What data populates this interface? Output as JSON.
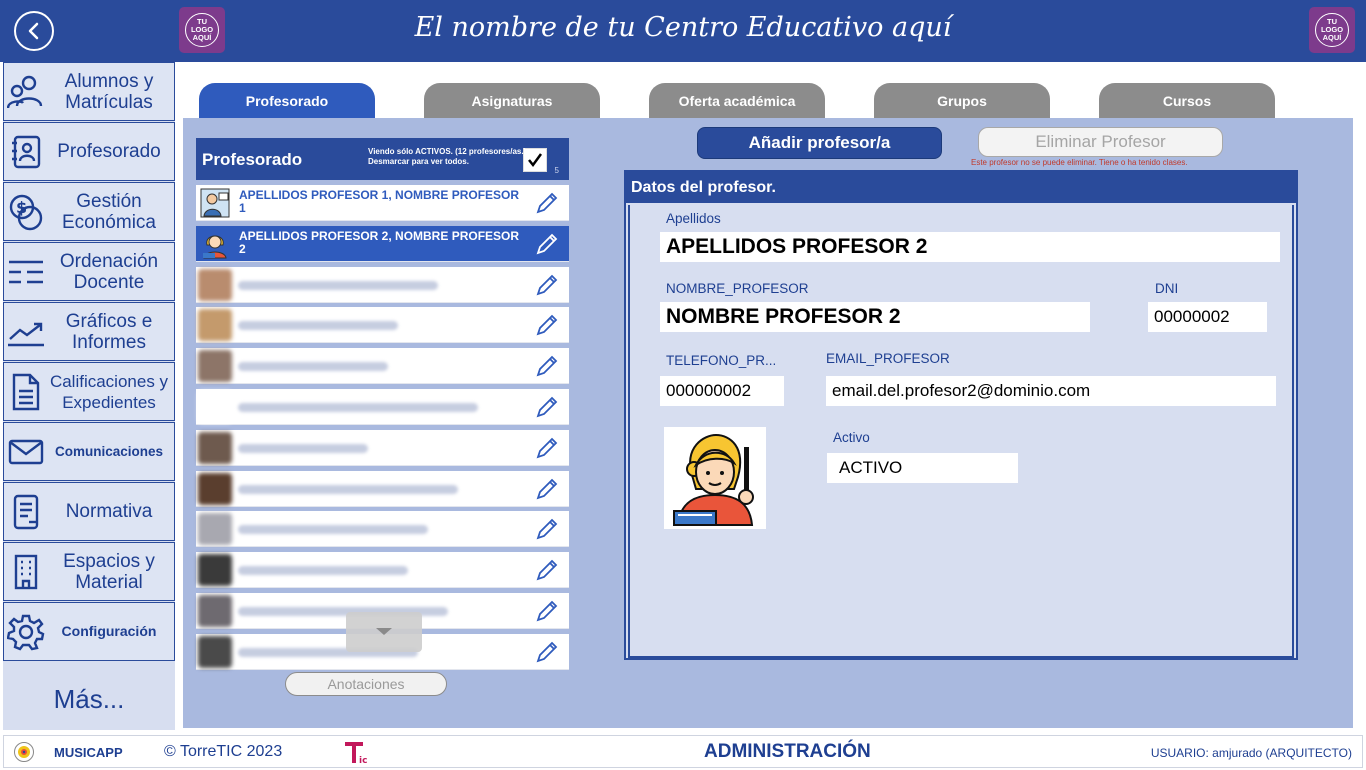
{
  "header": {
    "center_name": "El nombre de tu Centro Educativo aquí",
    "logo_text": [
      "TU",
      "LOGO",
      "AQUÍ"
    ]
  },
  "sidebar": {
    "items": [
      {
        "label": "Alumnos y Matrículas",
        "icon": "users-icon"
      },
      {
        "label": "Profesorado",
        "icon": "teacher-card-icon"
      },
      {
        "label": "Gestión Económica",
        "icon": "money-icon"
      },
      {
        "label": "Ordenación Docente",
        "icon": "list-icon"
      },
      {
        "label": "Gráficos e Informes",
        "icon": "chart-icon"
      },
      {
        "label": "Calificaciones y Expedientes",
        "icon": "document-icon"
      },
      {
        "label": "Comunicaciones",
        "icon": "envelope-icon"
      },
      {
        "label": "Normativa",
        "icon": "regulation-icon"
      },
      {
        "label": "Espacios y Material",
        "icon": "building-icon"
      },
      {
        "label": "Configuración",
        "icon": "gear-icon"
      }
    ],
    "more": "Más..."
  },
  "tabs": [
    {
      "label": "Profesorado",
      "active": true
    },
    {
      "label": "Asignaturas",
      "active": false
    },
    {
      "label": "Oferta académica",
      "active": false
    },
    {
      "label": "Grupos",
      "active": false
    },
    {
      "label": "Cursos",
      "active": false
    }
  ],
  "list": {
    "title": "Profesorado",
    "checked": true,
    "note_line1": "Viendo sólo ACTIVOS. (12 profesores/as.)",
    "note_line2": "Desmarcar para ver todos.",
    "count": "5",
    "rows": [
      {
        "name": "APELLIDOS PROFESOR 1, NOMBRE PROFESOR 1",
        "selected": false,
        "blurred": false
      },
      {
        "name": "APELLIDOS PROFESOR 2, NOMBRE PROFESOR 2",
        "selected": true,
        "blurred": false
      },
      {
        "name": "",
        "selected": false,
        "blurred": true
      },
      {
        "name": "",
        "selected": false,
        "blurred": true
      },
      {
        "name": "",
        "selected": false,
        "blurred": true
      },
      {
        "name": "",
        "selected": false,
        "blurred": true
      },
      {
        "name": "",
        "selected": false,
        "blurred": true
      },
      {
        "name": "",
        "selected": false,
        "blurred": true
      },
      {
        "name": "",
        "selected": false,
        "blurred": true
      },
      {
        "name": "",
        "selected": false,
        "blurred": true
      },
      {
        "name": "",
        "selected": false,
        "blurred": true
      },
      {
        "name": "",
        "selected": false,
        "blurred": true
      }
    ],
    "annotations_button": "Anotaciones"
  },
  "actions": {
    "add_label": "Añadir profesor/a",
    "delete_label": "Eliminar Profesor",
    "delete_warning": "Este profesor no se puede eliminar. Tiene o ha tenido clases."
  },
  "detail": {
    "title": "Datos del profesor.",
    "apellidos_label": "Apellidos",
    "apellidos_value": "APELLIDOS PROFESOR 2",
    "nombre_label": "NOMBRE_PROFESOR",
    "nombre_value": "NOMBRE PROFESOR 2",
    "dni_label": "DNI",
    "dni_value": "00000002",
    "telefono_label": "TELEFONO_PR...",
    "telefono_value": "000000002",
    "email_label": "EMAIL_PROFESOR",
    "email_value": "email.del.profesor2@dominio.com",
    "activo_label": "Activo",
    "activo_value": "ACTIVO"
  },
  "footer": {
    "app_name": "MUSICAPP",
    "copyright": "© TorreTIC  2023",
    "section": "ADMINISTRACIÓN",
    "user": "USUARIO: amjurado (ARQUITECTO)"
  },
  "colors": {
    "primary": "#2a4b9b",
    "tab_active": "#2f5bbd",
    "tab_inactive": "#8c8c8c",
    "main_bg": "#a9b9df",
    "logo_purple": "#7d3b8c",
    "warning": "#c0392b"
  }
}
